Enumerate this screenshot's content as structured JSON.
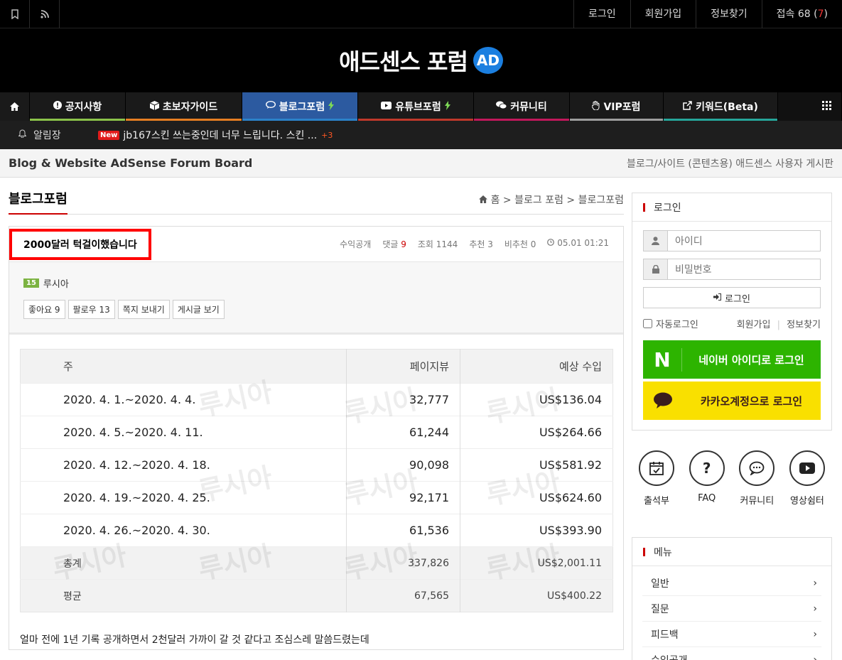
{
  "topbar": {
    "login": "로그인",
    "signup": "회원가입",
    "find": "정보찾기",
    "visitors_label": "접속 68",
    "visitors_open": " (",
    "visitors_new": "7",
    "visitors_close": ")"
  },
  "logo": {
    "text": "애드센스 포럼",
    "badge": "AD"
  },
  "nav": {
    "items": [
      {
        "label": "공지사항",
        "color": "#8bc34a"
      },
      {
        "label": "초보자가이드",
        "color": "#e67e22"
      },
      {
        "label": "블로그포럼",
        "color": "#2c82c9"
      },
      {
        "label": "유튜브포럼",
        "color": "#c0392b"
      },
      {
        "label": "커뮤니티",
        "color": "#c2185b"
      },
      {
        "label": "VIP포럼",
        "color": "#9e9e9e"
      },
      {
        "label": "키워드(Beta)",
        "color": "#26a69a"
      }
    ]
  },
  "ticker": {
    "label": "알림장",
    "new_badge": "New",
    "text": "jb167스킨 쓰는중인데 너무 느립니다. 스킨 ...",
    "count": "+3"
  },
  "sub_banner": {
    "left": "Blog & Website AdSense Forum Board",
    "right": "블로그/사이트 (콘텐츠용) 애드센스 사용자 게시판"
  },
  "page": {
    "title": "블로그포럼",
    "breadcrumb_home": "홈",
    "breadcrumb": " > 블로그 포럼 > 블로그포럼"
  },
  "post": {
    "title": "2000달러 턱걸이했습니다",
    "category": "수익공개",
    "comments_label": "댓글",
    "comments": "9",
    "views": "조회   1144",
    "likes": "추천 3",
    "dislikes": "비추천 0",
    "date": "05.01 01:21",
    "author_level": "15",
    "author": "루시아",
    "buttons": [
      "좋아요 9",
      "팔로우 13",
      "쪽지 보내기",
      "게시글 보기"
    ],
    "body": "얼마 전에 1년 기록 공개하면서 2천달러 가까이 갈 것 같다고 조심스레 말씀드렸는데"
  },
  "table": {
    "headers": [
      "주",
      "페이지뷰",
      "예상 수입"
    ],
    "rows": [
      [
        "2020. 4. 1.~2020. 4. 4.",
        "32,777",
        "US$136.04"
      ],
      [
        "2020. 4. 5.~2020. 4. 11.",
        "61,244",
        "US$264.66"
      ],
      [
        "2020. 4. 12.~2020. 4. 18.",
        "90,098",
        "US$581.92"
      ],
      [
        "2020. 4. 19.~2020. 4. 25.",
        "92,171",
        "US$624.60"
      ],
      [
        "2020. 4. 26.~2020. 4. 30.",
        "61,536",
        "US$393.90"
      ]
    ],
    "total": [
      "총계",
      "337,826",
      "US$2,001.11"
    ],
    "average": [
      "평균",
      "67,565",
      "US$400.22"
    ],
    "watermark": "루시아"
  },
  "sidebar": {
    "login_title": "로그인",
    "id_placeholder": "아이디",
    "pw_placeholder": "비밀번호",
    "login_button": "로그인",
    "auto_login": "자동로그인",
    "signup": "회원가입",
    "find": "정보찾기",
    "naver": "네이버 아이디로 로그인",
    "kakao": "카카오계정으로 로그인",
    "quick": [
      "출석부",
      "FAQ",
      "커뮤니티",
      "영상쉼터"
    ],
    "menu_title": "메뉴",
    "menu": [
      "일반",
      "질문",
      "피드백",
      "수익공개"
    ]
  }
}
